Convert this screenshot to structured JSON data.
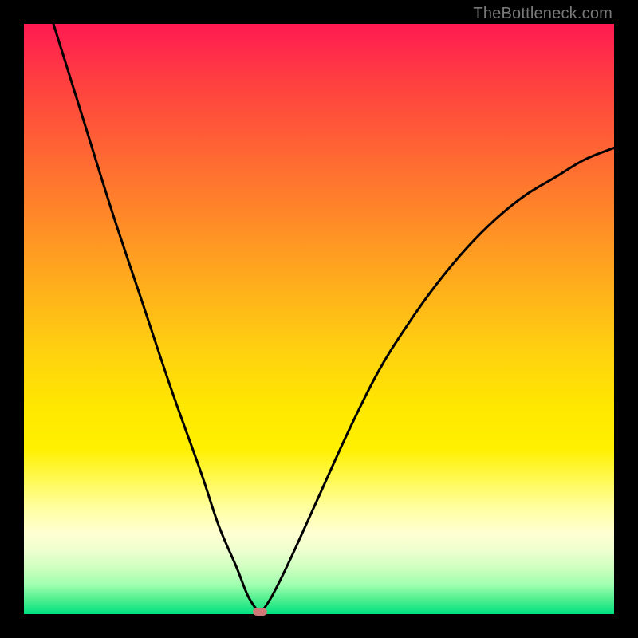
{
  "watermark": "TheBottleneck.com",
  "colors": {
    "frame": "#000000",
    "gradient_top": "#ff1a52",
    "gradient_bottom": "#00e080",
    "curve": "#000000",
    "marker": "#cf7a78"
  },
  "chart_data": {
    "type": "line",
    "title": "",
    "xlabel": "",
    "ylabel": "",
    "xlim": [
      0,
      100
    ],
    "ylim": [
      0,
      100
    ],
    "grid": false,
    "legend": false,
    "notes": "V-shaped bottleneck curve. y represents mismatch/bottleneck percentage (0 = optimal, near bottom). Minimum occurs near x≈40. Left branch enters from top-left; right branch exits near top-right.",
    "minimum": {
      "x": 40,
      "y": 0
    },
    "series": [
      {
        "name": "bottleneck-left",
        "x": [
          5,
          10,
          15,
          20,
          25,
          30,
          33,
          36,
          38,
          40
        ],
        "values": [
          100,
          84,
          68,
          53,
          38,
          24,
          15,
          8,
          3,
          0
        ]
      },
      {
        "name": "bottleneck-right",
        "x": [
          40,
          42,
          45,
          50,
          55,
          60,
          65,
          70,
          75,
          80,
          85,
          90,
          95,
          100
        ],
        "values": [
          0,
          3,
          9,
          20,
          31,
          41,
          49,
          56,
          62,
          67,
          71,
          74,
          77,
          79
        ]
      }
    ],
    "marker": {
      "x": 40,
      "y": 0,
      "label": ""
    }
  }
}
